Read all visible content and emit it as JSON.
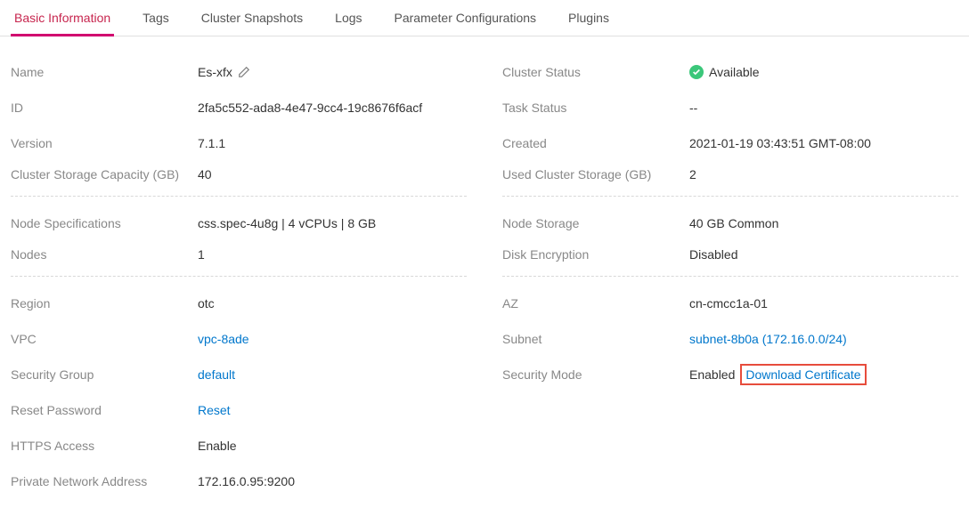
{
  "tabs": {
    "t0": "Basic Information",
    "t1": "Tags",
    "t2": "Cluster Snapshots",
    "t3": "Logs",
    "t4": "Parameter Configurations",
    "t5": "Plugins"
  },
  "left": {
    "name_label": "Name",
    "name_value": "Es-xfx",
    "id_label": "ID",
    "id_value": "2fa5c552-ada8-4e47-9cc4-19c8676f6acf",
    "version_label": "Version",
    "version_value": "7.1.1",
    "storage_cap_label": "Cluster Storage Capacity (GB)",
    "storage_cap_value": "40",
    "node_spec_label": "Node Specifications",
    "node_spec_value": "css.spec-4u8g | 4 vCPUs | 8 GB",
    "nodes_label": "Nodes",
    "nodes_value": "1",
    "region_label": "Region",
    "region_value": "otc",
    "vpc_label": "VPC",
    "vpc_value": "vpc-8ade",
    "sg_label": "Security Group",
    "sg_value": "default",
    "reset_label": "Reset Password",
    "reset_value": "Reset",
    "https_label": "HTTPS Access",
    "https_value": "Enable",
    "priv_addr_label": "Private Network Address",
    "priv_addr_value": "172.16.0.95:9200"
  },
  "right": {
    "status_label": "Cluster Status",
    "status_value": "Available",
    "task_label": "Task Status",
    "task_value": "--",
    "created_label": "Created",
    "created_value": "2021-01-19 03:43:51 GMT-08:00",
    "used_storage_label": "Used Cluster Storage (GB)",
    "used_storage_value": "2",
    "node_storage_label": "Node Storage",
    "node_storage_value": "40 GB Common",
    "disk_enc_label": "Disk Encryption",
    "disk_enc_value": "Disabled",
    "az_label": "AZ",
    "az_value": "cn-cmcc1a-01",
    "subnet_label": "Subnet",
    "subnet_value": "subnet-8b0a (172.16.0.0/24)",
    "sec_mode_label": "Security Mode",
    "sec_mode_value": "Enabled",
    "download_cert": "Download Certificate"
  }
}
